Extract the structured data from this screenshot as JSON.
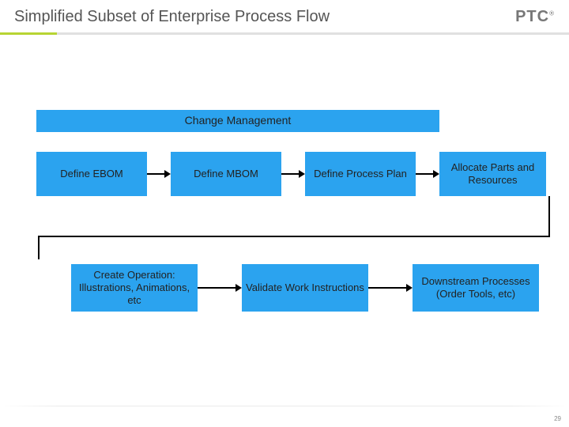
{
  "header": {
    "title": "Simplified Subset of Enterprise Process Flow",
    "logo_text": "PTC",
    "logo_reg": "®"
  },
  "diagram": {
    "change_mgmt": "Change Management",
    "row1": {
      "b1": "Define EBOM",
      "b2": "Define MBOM",
      "b3": "Define Process Plan",
      "b4": "Allocate Parts and Resources"
    },
    "row2": {
      "b5": "Create Operation: Illustrations, Animations, etc",
      "b6": "Validate Work Instructions",
      "b7": "Downstream Processes\n(Order Tools, etc)"
    }
  },
  "footer": {
    "page_number": "29"
  }
}
